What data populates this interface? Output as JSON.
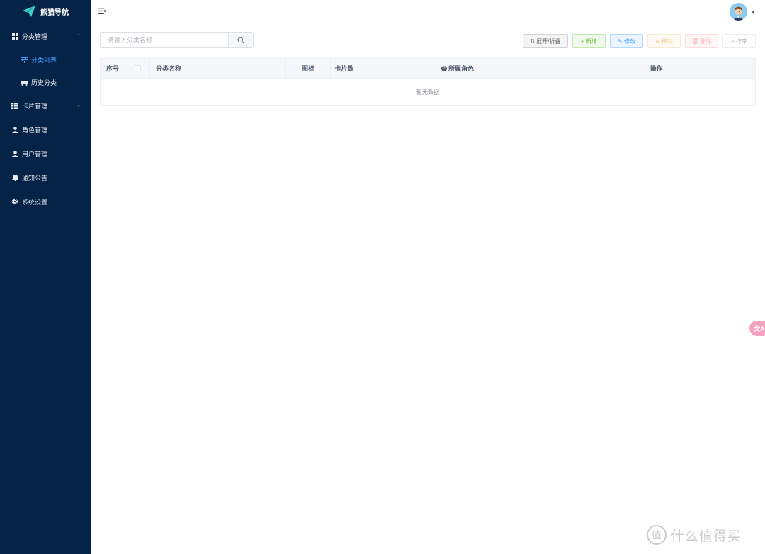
{
  "sidebar": {
    "logo_text": "熊猫导航",
    "menu": {
      "category_mgmt": "分类管理",
      "category_list": "分类列表",
      "history_category": "历史分类",
      "card_mgmt": "卡片管理",
      "role_mgmt": "角色管理",
      "user_mgmt": "用户管理",
      "notice": "通知公告",
      "system_settings": "系统设置"
    }
  },
  "search": {
    "placeholder": "请输入分类名称",
    "value": ""
  },
  "toolbar": {
    "expand_label": "展开/折叠",
    "add_label": "新增",
    "edit_label": "修改",
    "move_label": "移除",
    "delete_label": "删除",
    "sort_label": "排序"
  },
  "table": {
    "columns": {
      "index": "序号",
      "name": "分类名称",
      "icon": "图标",
      "card_count": "卡片数",
      "roles": "所属角色",
      "actions": "操作"
    },
    "rows": [],
    "empty_text": "暂无数据"
  },
  "float_button": {
    "label": "文A"
  },
  "watermark": {
    "glyph": "值",
    "text": "什么值得买"
  },
  "colors": {
    "sidebar_bg": "#052247",
    "accent": "#409eff",
    "success": "#67c23a",
    "warning": "#e6a23c",
    "danger": "#f56c6c"
  }
}
